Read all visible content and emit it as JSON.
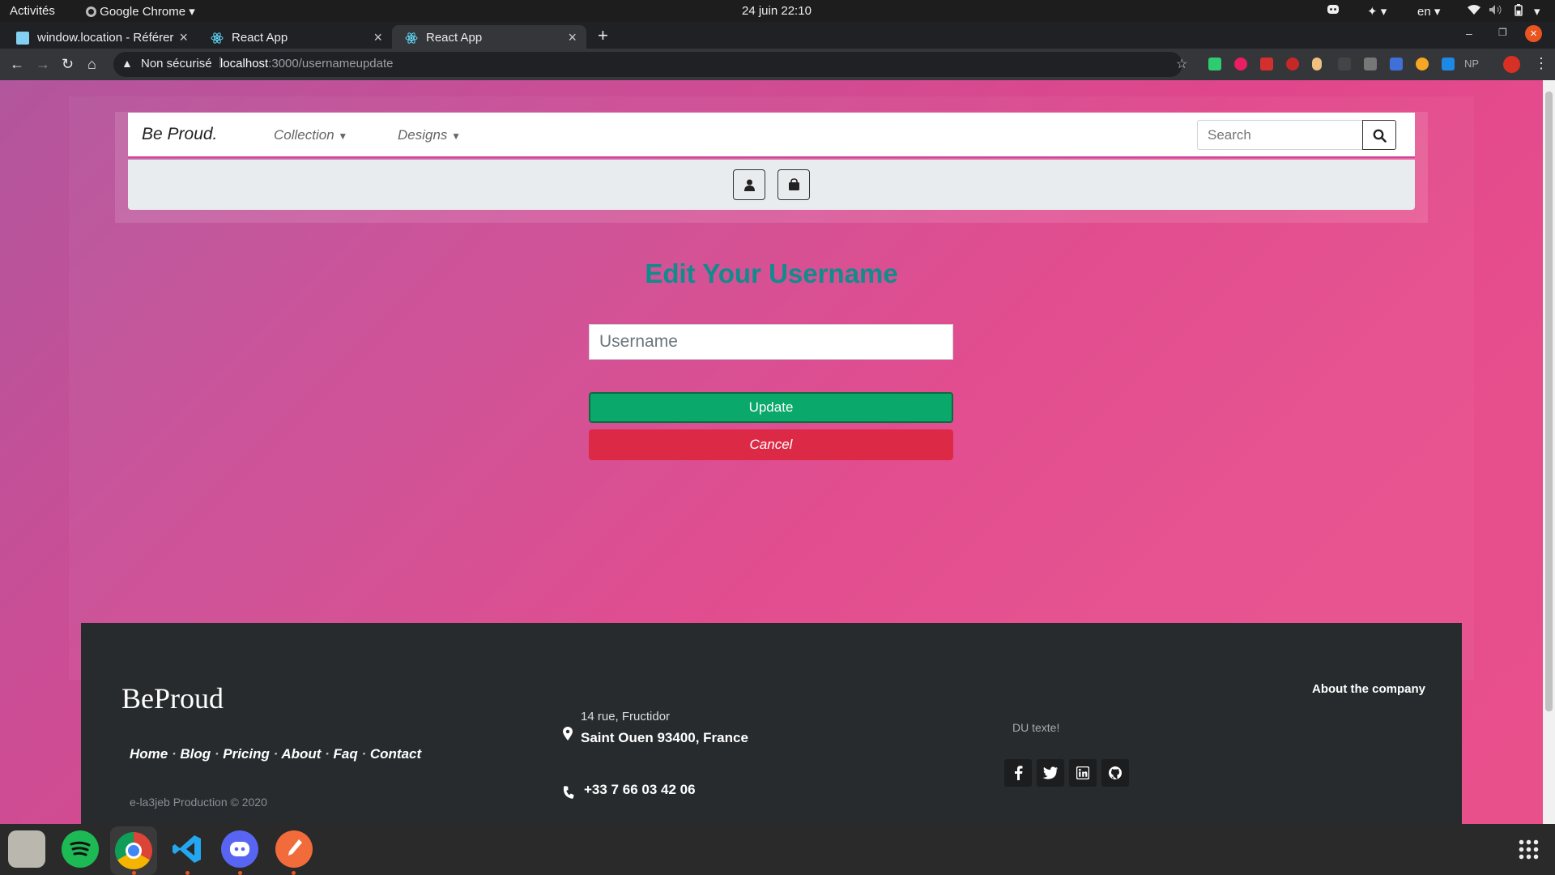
{
  "system": {
    "activities": "Activités",
    "app_menu": "Google Chrome",
    "clock": "24 juin  22:10",
    "language": "en"
  },
  "browser": {
    "tabs": [
      {
        "title": "window.location - Référer"
      },
      {
        "title": "React App"
      },
      {
        "title": "React App"
      }
    ],
    "security_label": "Non sécurisé",
    "url_host": "localhost",
    "url_rest": ":3000/usernameupdate",
    "ext_np": "NP"
  },
  "navbar": {
    "brand": "Be Proud.",
    "menu": [
      {
        "label": "Collection"
      },
      {
        "label": "Designs"
      }
    ],
    "search_placeholder": "Search"
  },
  "form": {
    "title": "Edit Your Username",
    "username_placeholder": "Username",
    "update_label": "Update",
    "cancel_label": "Cancel"
  },
  "footer": {
    "brand": "BeProud",
    "links": [
      {
        "label": "Home"
      },
      {
        "label": "Blog"
      },
      {
        "label": "Pricing"
      },
      {
        "label": "About"
      },
      {
        "label": "Faq"
      },
      {
        "label": "Contact"
      }
    ],
    "copyright": "e-la3jeb Production © 2020",
    "address_line1": "14 rue, Fructidor",
    "address_line2": "Saint Ouen 93400, France",
    "phone": "+33 7 66 03 42 06",
    "about_heading": "About the company",
    "about_text": "DU texte!"
  },
  "colors": {
    "accent_teal": "#0f8c8c",
    "update_green": "#0aa86b",
    "cancel_red": "#dc2a46",
    "footer_bg": "#272b2e"
  }
}
